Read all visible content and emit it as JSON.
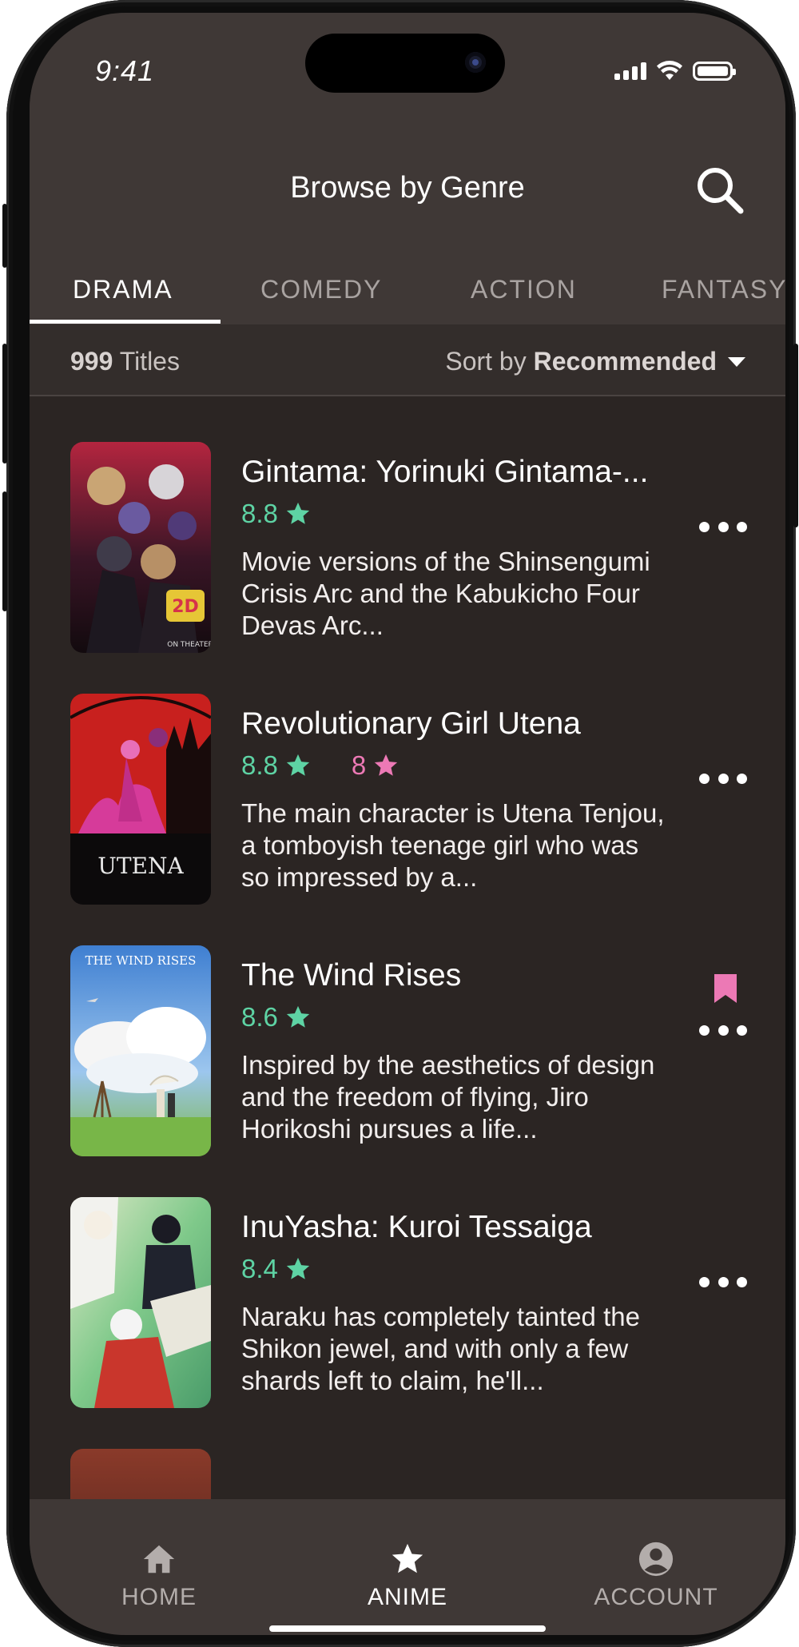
{
  "status": {
    "time": "9:41"
  },
  "header": {
    "title": "Browse by Genre"
  },
  "tabs": [
    {
      "label": "DRAMA",
      "active": true
    },
    {
      "label": "COMEDY",
      "active": false
    },
    {
      "label": "ACTION",
      "active": false
    },
    {
      "label": "FANTASY",
      "active": false
    }
  ],
  "filter": {
    "count": "999",
    "count_suffix": " Titles",
    "sort_prefix": "Sort by ",
    "sort_value": "Recommended"
  },
  "items": [
    {
      "title": "Gintama: Yorinuki Gintama-...",
      "rating": "8.8",
      "description": "Movie versions of the Shinsengumi Crisis Arc and the Kabukicho Four Devas Arc...",
      "poster_text": "ON THEATER"
    },
    {
      "title": "Revolutionary Girl Utena",
      "rating": "8.8",
      "user_rating": "8",
      "description": "The main character is Utena Tenjou, a tomboyish teenage girl who was so impressed by a...",
      "poster_text": "UTENA"
    },
    {
      "title": "The Wind Rises",
      "rating": "8.6",
      "description": "Inspired by the aesthetics of design and the freedom of flying, Jiro Horikoshi pursues a life...",
      "poster_text": "THE WIND RISES",
      "bookmarked": true
    },
    {
      "title": "InuYasha: Kuroi Tessaiga",
      "rating": "8.4",
      "description": "Naraku has completely tainted the Shikon jewel, and with only a few shards left to claim, he'll..."
    }
  ],
  "bottom_nav": [
    {
      "label": "HOME",
      "icon": "home-icon",
      "active": false
    },
    {
      "label": "ANIME",
      "icon": "star-icon",
      "active": true
    },
    {
      "label": "ACCOUNT",
      "icon": "account-icon",
      "active": false
    }
  ],
  "colors": {
    "background": "#2b2523",
    "header": "#3f3836",
    "rating_green": "#5ed3a4",
    "rating_pink": "#ec79b5"
  }
}
